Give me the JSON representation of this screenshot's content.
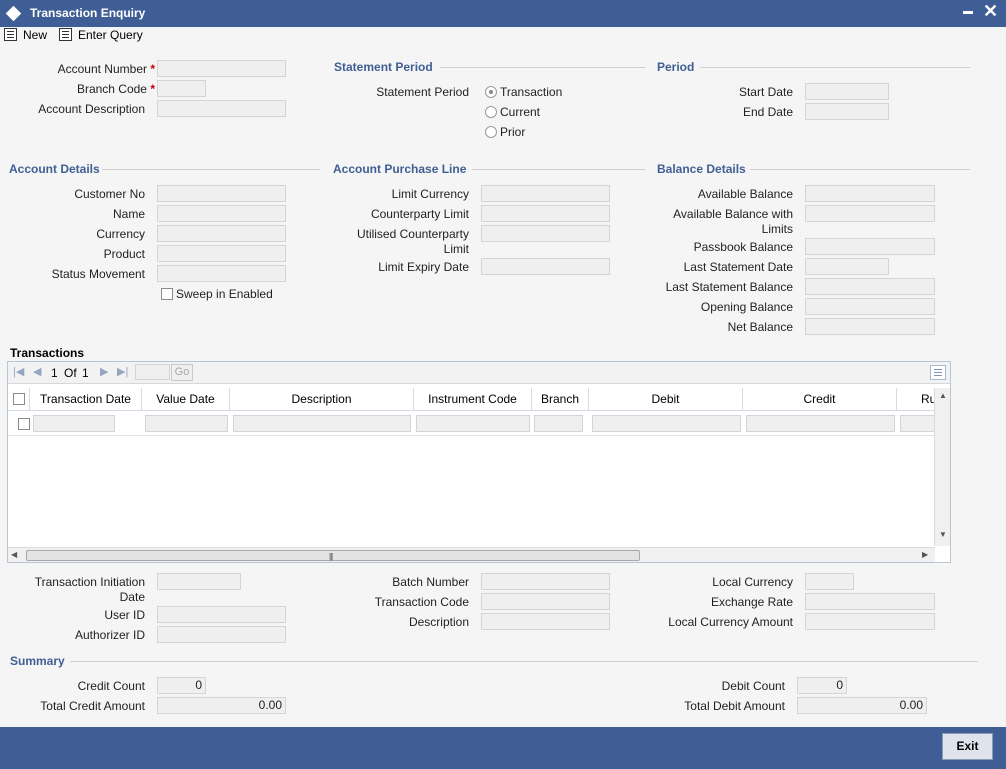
{
  "window": {
    "title": "Transaction Enquiry"
  },
  "toolbar": {
    "new_label": "New",
    "enter_query_label": "Enter Query"
  },
  "account": {
    "account_number_label": "Account Number",
    "branch_code_label": "Branch Code",
    "account_description_label": "Account Description",
    "required_mark": "*"
  },
  "statement_period": {
    "heading": "Statement Period",
    "label": "Statement Period",
    "options": [
      "Transaction",
      "Current",
      "Prior"
    ],
    "selected": "Transaction"
  },
  "period": {
    "heading": "Period",
    "start_date_label": "Start Date",
    "end_date_label": "End Date"
  },
  "account_details": {
    "heading": "Account Details",
    "customer_no_label": "Customer No",
    "name_label": "Name",
    "currency_label": "Currency",
    "product_label": "Product",
    "status_movement_label": "Status Movement",
    "sweep_label": "Sweep in Enabled"
  },
  "purchase_line": {
    "heading": "Account Purchase Line",
    "limit_currency_label": "Limit Currency",
    "counterparty_limit_label": "Counterparty Limit",
    "utilised_limit_label": "Utilised Counterparty Limit",
    "limit_expiry_label": "Limit Expiry Date"
  },
  "balance": {
    "heading": "Balance Details",
    "available_label": "Available Balance",
    "available_limits_label": "Available Balance with Limits",
    "passbook_label": "Passbook Balance",
    "last_stmt_date_label": "Last Statement Date",
    "last_stmt_balance_label": "Last Statement Balance",
    "opening_label": "Opening Balance",
    "net_label": "Net Balance"
  },
  "transactions": {
    "heading": "Transactions",
    "page_current": "1",
    "page_of": "Of",
    "page_total": "1",
    "go_label": "Go",
    "columns": [
      "Transaction Date",
      "Value Date",
      "Description",
      "Instrument Code",
      "Branch",
      "Debit",
      "Credit",
      "Ru"
    ]
  },
  "details": {
    "txn_init_date_label": "Transaction Initiation Date",
    "user_id_label": "User ID",
    "authorizer_id_label": "Authorizer ID",
    "batch_number_label": "Batch Number",
    "transaction_code_label": "Transaction Code",
    "description_label": "Description",
    "local_currency_label": "Local Currency",
    "exchange_rate_label": "Exchange Rate",
    "local_currency_amount_label": "Local Currency Amount"
  },
  "summary": {
    "heading": "Summary",
    "credit_count_label": "Credit Count",
    "credit_count": "0",
    "total_credit_label": "Total Credit Amount",
    "total_credit": "0.00",
    "debit_count_label": "Debit Count",
    "debit_count": "0",
    "total_debit_label": "Total Debit Amount",
    "total_debit": "0.00"
  },
  "footer": {
    "exit_label": "Exit"
  },
  "colors": {
    "title_bar": "#3e5e95",
    "section_heading": "#3f5f93",
    "required": "#c00000"
  }
}
